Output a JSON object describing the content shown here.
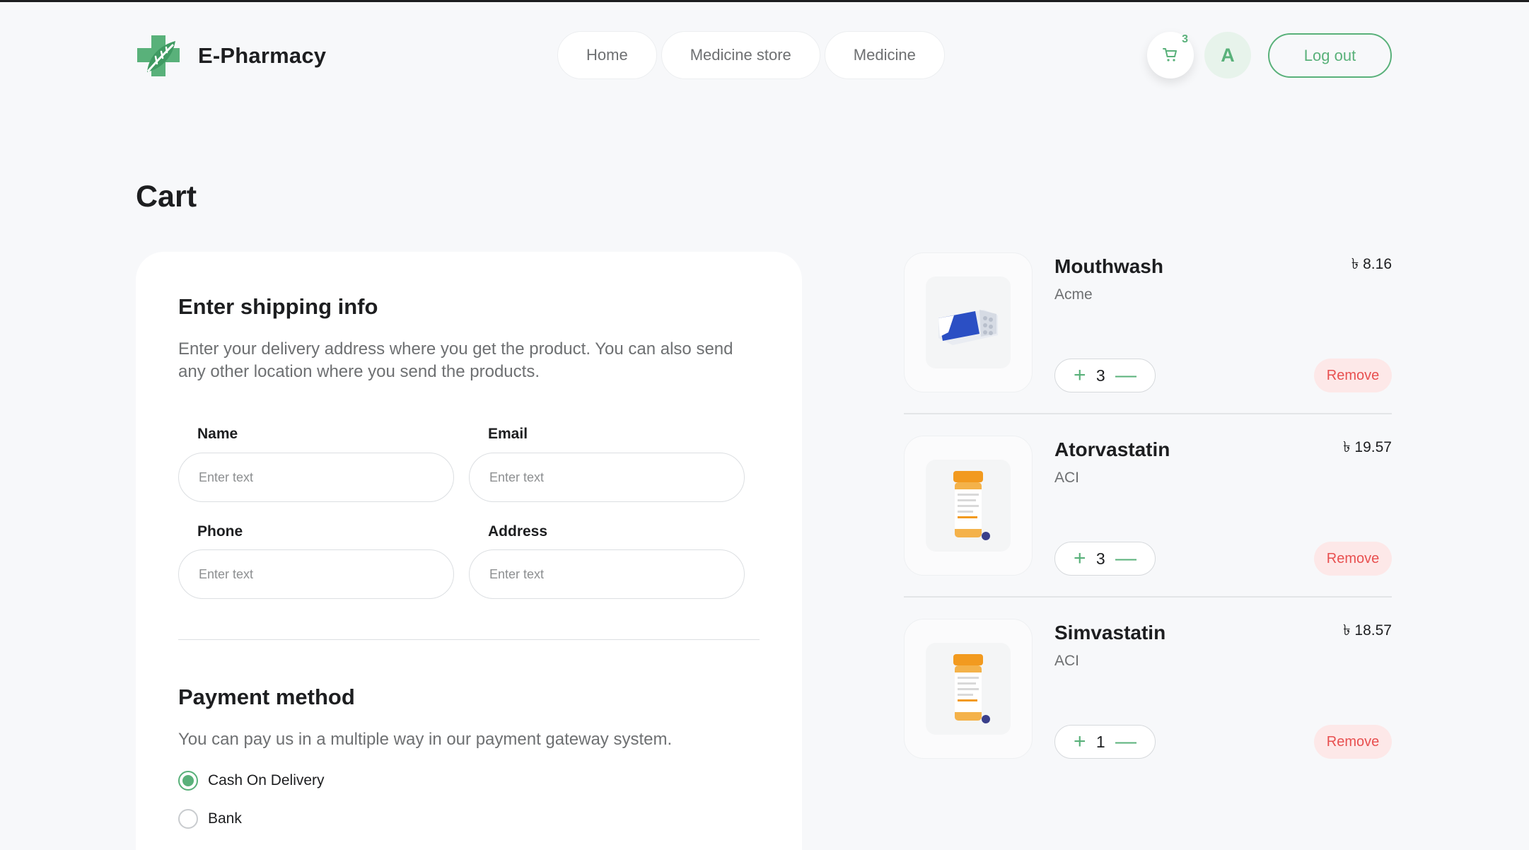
{
  "brand": {
    "name": "E-Pharmacy",
    "accent_color": "#59b17a",
    "logo_icon": "leaf-cross-icon"
  },
  "nav": {
    "items": [
      {
        "label": "Home"
      },
      {
        "label": "Medicine store"
      },
      {
        "label": "Medicine"
      }
    ]
  },
  "header": {
    "cart_count": "3",
    "avatar_initial": "A",
    "logout_label": "Log out",
    "cart_icon": "cart-icon"
  },
  "page": {
    "title": "Cart"
  },
  "shipping": {
    "title": "Enter shipping info",
    "description": "Enter your delivery address where you get the product. You can also send any other location where you send the products.",
    "fields": {
      "name": {
        "label": "Name",
        "placeholder": "Enter text",
        "value": ""
      },
      "email": {
        "label": "Email",
        "placeholder": "Enter text",
        "value": ""
      },
      "phone": {
        "label": "Phone",
        "placeholder": "Enter text",
        "value": ""
      },
      "address": {
        "label": "Address",
        "placeholder": "Enter text",
        "value": ""
      }
    }
  },
  "payment": {
    "title": "Payment method",
    "description": "You can pay us in a multiple way in our payment gateway system.",
    "options": [
      {
        "label": "Cash On Delivery",
        "selected": true
      },
      {
        "label": "Bank",
        "selected": false
      }
    ]
  },
  "cart": {
    "items": [
      {
        "name": "Mouthwash",
        "brand": "Acme",
        "price": "৳ 8.16",
        "quantity": "3",
        "remove_label": "Remove",
        "image": "pill-box-image"
      },
      {
        "name": "Atorvastatin",
        "brand": "ACI",
        "price": "৳ 19.57",
        "quantity": "3",
        "remove_label": "Remove",
        "image": "pill-bottle-image"
      },
      {
        "name": "Simvastatin",
        "brand": "ACI",
        "price": "৳ 18.57",
        "quantity": "1",
        "remove_label": "Remove",
        "image": "pill-bottle-image"
      }
    ],
    "increment_symbol": "+",
    "decrement_symbol": "—"
  }
}
